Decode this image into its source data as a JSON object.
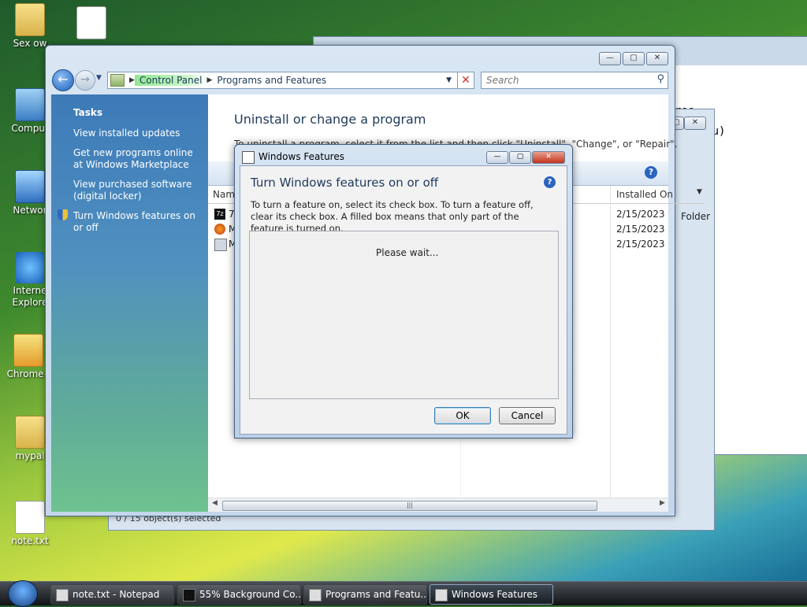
{
  "desktop": {
    "icons": [
      {
        "label": "Sex ow"
      },
      {
        "label": ""
      },
      {
        "label": "Comput"
      },
      {
        "label": "Networ"
      },
      {
        "label": "Interne\nExplore"
      },
      {
        "label": "Chrome-l"
      },
      {
        "label": "mypal"
      },
      {
        "label": "note.txt"
      }
    ]
  },
  "bg_notepad": {
    "line1": "ree",
    "line2": "uck you)"
  },
  "bg_7zip": {
    "status": "0 / 15 object(s) selected"
  },
  "control_panel": {
    "breadcrumb": [
      "Control Panel",
      "Programs and Features"
    ],
    "search_placeholder": "Search",
    "tasks": {
      "heading": "Tasks",
      "links": [
        "View installed updates",
        "Get new programs online at Windows Marketplace",
        "View purchased software (digital locker)",
        "Turn Windows features on or off"
      ]
    },
    "title": "Uninstall or change a program",
    "description": "To uninstall a program, select it from the list and then click \"Uninstall\", \"Change\", or \"Repair\".",
    "columns": {
      "name": "Nam",
      "installed_on": "Installed On"
    },
    "rows": [
      {
        "name": "7",
        "date": "2/15/2023"
      },
      {
        "name": "M",
        "date": "2/15/2023"
      },
      {
        "name": "M",
        "date": "2/15/2023"
      }
    ],
    "extra_column_value": "Folder"
  },
  "dialog": {
    "title": "Windows Features",
    "heading": "Turn Windows features on or off",
    "text": "To turn a feature on, select its check box. To turn a feature off, clear its check box. A filled box means that only part of the feature is turned on.",
    "wait": "Please wait...",
    "ok": "OK",
    "cancel": "Cancel"
  },
  "taskbar": {
    "items": [
      {
        "label": "note.txt - Notepad"
      },
      {
        "label": "55% Background Co..."
      },
      {
        "label": "Programs and Featu..."
      },
      {
        "label": "Windows Features"
      }
    ]
  }
}
